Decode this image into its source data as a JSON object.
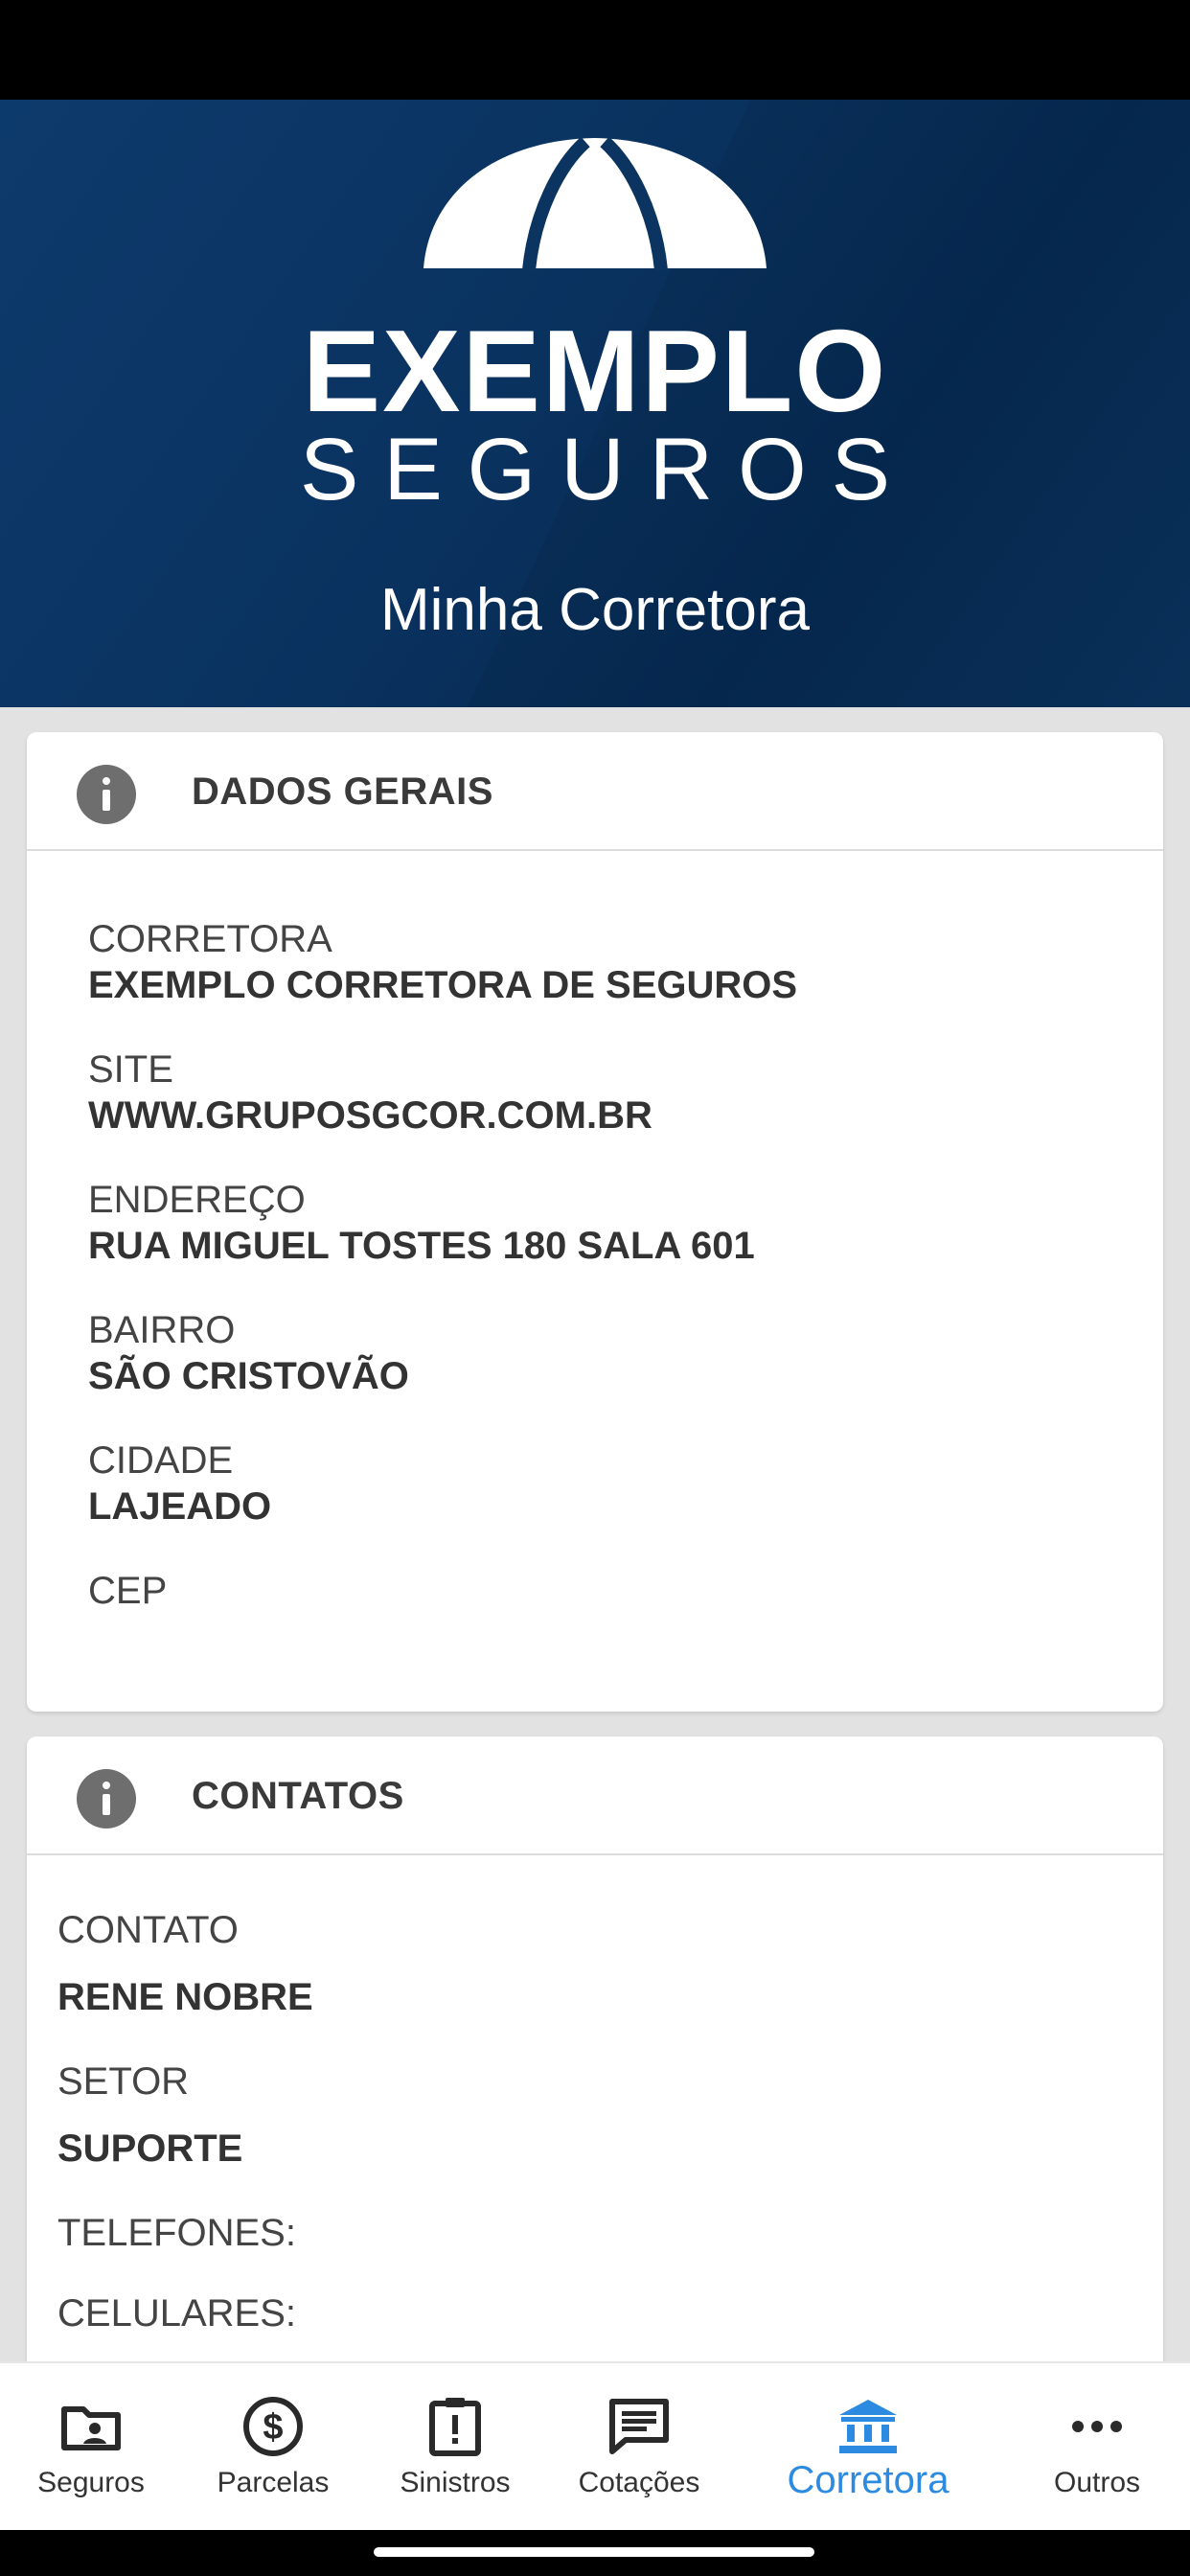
{
  "header": {
    "logo_line1": "EXEMPLO",
    "logo_line2": "SEGUROS",
    "title": "Minha Corretora"
  },
  "dados_gerais": {
    "title": "DADOS GERAIS",
    "fields": [
      {
        "label": "CORRETORA",
        "value": "EXEMPLO CORRETORA DE SEGUROS"
      },
      {
        "label": "SITE",
        "value": "WWW.GRUPOSGCOR.COM.BR"
      },
      {
        "label": "ENDEREÇO",
        "value": "RUA MIGUEL TOSTES 180 SALA 601"
      },
      {
        "label": "BAIRRO",
        "value": "SÃO CRISTOVÃO"
      },
      {
        "label": "CIDADE",
        "value": "LAJEADO"
      },
      {
        "label": "CEP",
        "value": ""
      }
    ]
  },
  "contatos": {
    "title": "CONTATOS",
    "fields": [
      {
        "label": "CONTATO",
        "value": "RENE NOBRE"
      },
      {
        "label": "SETOR",
        "value": "SUPORTE"
      },
      {
        "label": "TELEFONES:",
        "value": ""
      },
      {
        "label": "CELULARES:",
        "value": ""
      }
    ]
  },
  "nav": {
    "items": [
      {
        "label": "Seguros",
        "icon": "folder-user-icon"
      },
      {
        "label": "Parcelas",
        "icon": "dollar-circle-icon"
      },
      {
        "label": "Sinistros",
        "icon": "clipboard-alert-icon"
      },
      {
        "label": "Cotações",
        "icon": "message-icon"
      },
      {
        "label": "Corretora",
        "icon": "bank-icon",
        "active": true
      },
      {
        "label": "Outros",
        "icon": "more-dots-icon"
      }
    ],
    "active_color": "#2c8be0"
  }
}
